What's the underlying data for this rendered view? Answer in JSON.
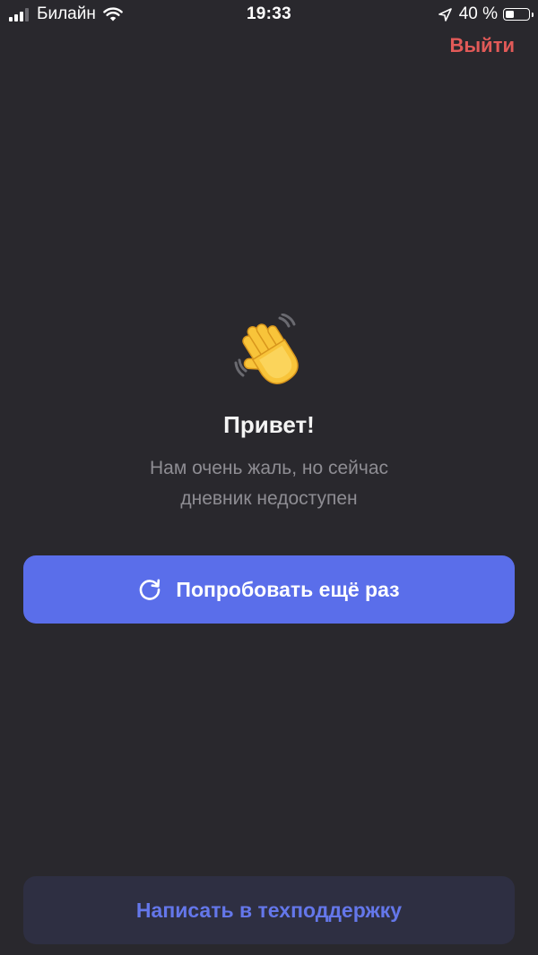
{
  "status_bar": {
    "carrier": "Билайн",
    "time": "19:33",
    "battery": "40 %",
    "battery_level": 0.4
  },
  "header": {
    "logout_label": "Выйти"
  },
  "main": {
    "title": "Привет!",
    "message_line1": "Нам очень жаль, но сейчас",
    "message_line2": "дневник недоступен",
    "retry_label": "Попробовать ещё раз"
  },
  "footer": {
    "support_label": "Написать в техподдержку"
  },
  "colors": {
    "background": "#29282d",
    "accent": "#5a6eea",
    "logout": "#e25a58",
    "support_bg": "#2e2f42",
    "support_text": "#6477ea"
  },
  "icons": [
    "signal-icon",
    "wifi-icon",
    "location-icon",
    "battery-icon",
    "waving-hand-icon",
    "refresh-icon"
  ]
}
